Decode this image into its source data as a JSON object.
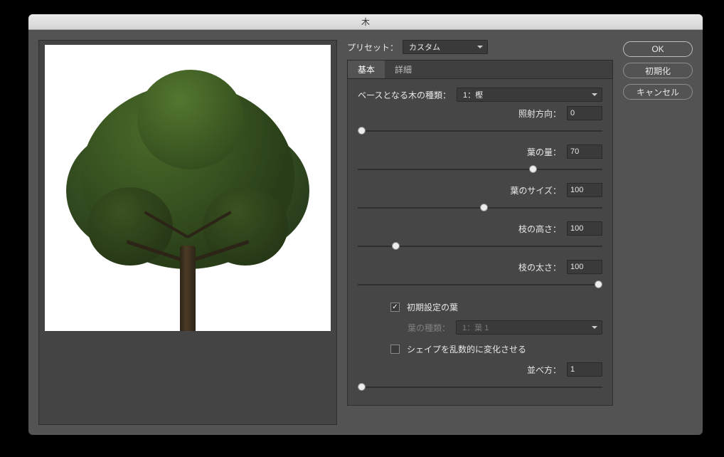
{
  "window": {
    "title": "木"
  },
  "preset": {
    "label": "プリセット：",
    "value": "カスタム"
  },
  "tabs": {
    "basic": "基本",
    "advanced": "詳細",
    "active": "basic"
  },
  "fields": {
    "baseTreeType": {
      "label": "ベースとなる木の種類：",
      "value": "1：樫"
    },
    "lightDirection": {
      "label": "照射方向：",
      "value": "0",
      "pos": 0
    },
    "leavesAmount": {
      "label": "葉の量：",
      "value": "70",
      "pos": 70
    },
    "leavesSize": {
      "label": "葉のサイズ：",
      "value": "100",
      "pos": 50
    },
    "branchHeight": {
      "label": "枝の高さ：",
      "value": "100",
      "pos": 14
    },
    "branchThickness": {
      "label": "枝の太さ：",
      "value": "100",
      "pos": 100
    },
    "defaultLeaves": {
      "label": "初期設定の葉",
      "checked": true
    },
    "leafType": {
      "label": "葉の種類：",
      "value": "1：葉 1"
    },
    "randomizeShape": {
      "label": "シェイプを乱数的に変化させる",
      "checked": false
    },
    "arrangement": {
      "label": "並べ方：",
      "value": "1",
      "pos": 0
    }
  },
  "buttons": {
    "ok": "OK",
    "reset": "初期化",
    "cancel": "キャンセル"
  }
}
